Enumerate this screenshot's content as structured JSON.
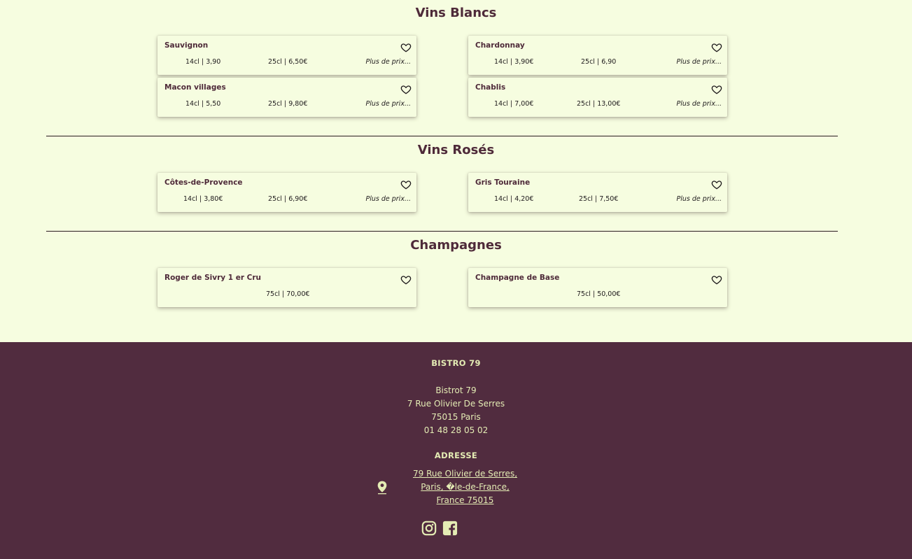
{
  "sections": [
    {
      "title": "Vins Blancs",
      "items": [
        {
          "name": "Sauvignon",
          "p1": "14cl | 3,90",
          "p2": "25cl | 6,50€",
          "more": "Plus de prix..."
        },
        {
          "name": "Chardonnay",
          "p1": "14cl | 3,90€",
          "p2": "25cl | 6,90",
          "more": "Plus de prix..."
        },
        {
          "name": "Macon villages",
          "p1": "14cl | 5,50",
          "p2": "25cl | 9,80€",
          "more": "Plus de prix..."
        },
        {
          "name": "Chablis",
          "p1": "14cl | 7,00€",
          "p2": "25cl | 13,00€",
          "more": "Plus de prix..."
        }
      ]
    },
    {
      "title": "Vins Rosés",
      "items": [
        {
          "name": "Côtes-de-Provence",
          "p1": "14cl | 3,80€",
          "p2": "25cl | 6,90€",
          "more": "Plus de prix..."
        },
        {
          "name": "Gris Touraine",
          "p1": "14cl | 4,20€",
          "p2": "25cl | 7,50€",
          "more": "Plus de prix..."
        }
      ]
    },
    {
      "title": "Champagnes",
      "items": [
        {
          "name": "Roger de Sivry 1 er Cru",
          "p1": "75cl | 70,00€"
        },
        {
          "name": "Champagne de Base",
          "p1": "75cl | 50,00€"
        }
      ]
    }
  ],
  "footer": {
    "brand": "BISTRO 79",
    "lines": [
      "Bistrot 79",
      "7 Rue Olivier De Serres",
      "75015 Paris",
      "01 48 28 05 02"
    ],
    "address_heading": "ADRESSE",
    "address_link": [
      "79 Rue Olivier de Serres,",
      "Paris, �le-de-France,",
      "France 75015"
    ]
  },
  "colors": {
    "background": "#f6fde0",
    "footer_bg": "#512c3f",
    "footer_text": "#e4ecb4",
    "title": "#4e2a39"
  },
  "icons": [
    "heart-icon",
    "location-pin-icon",
    "instagram-icon",
    "facebook-icon"
  ]
}
